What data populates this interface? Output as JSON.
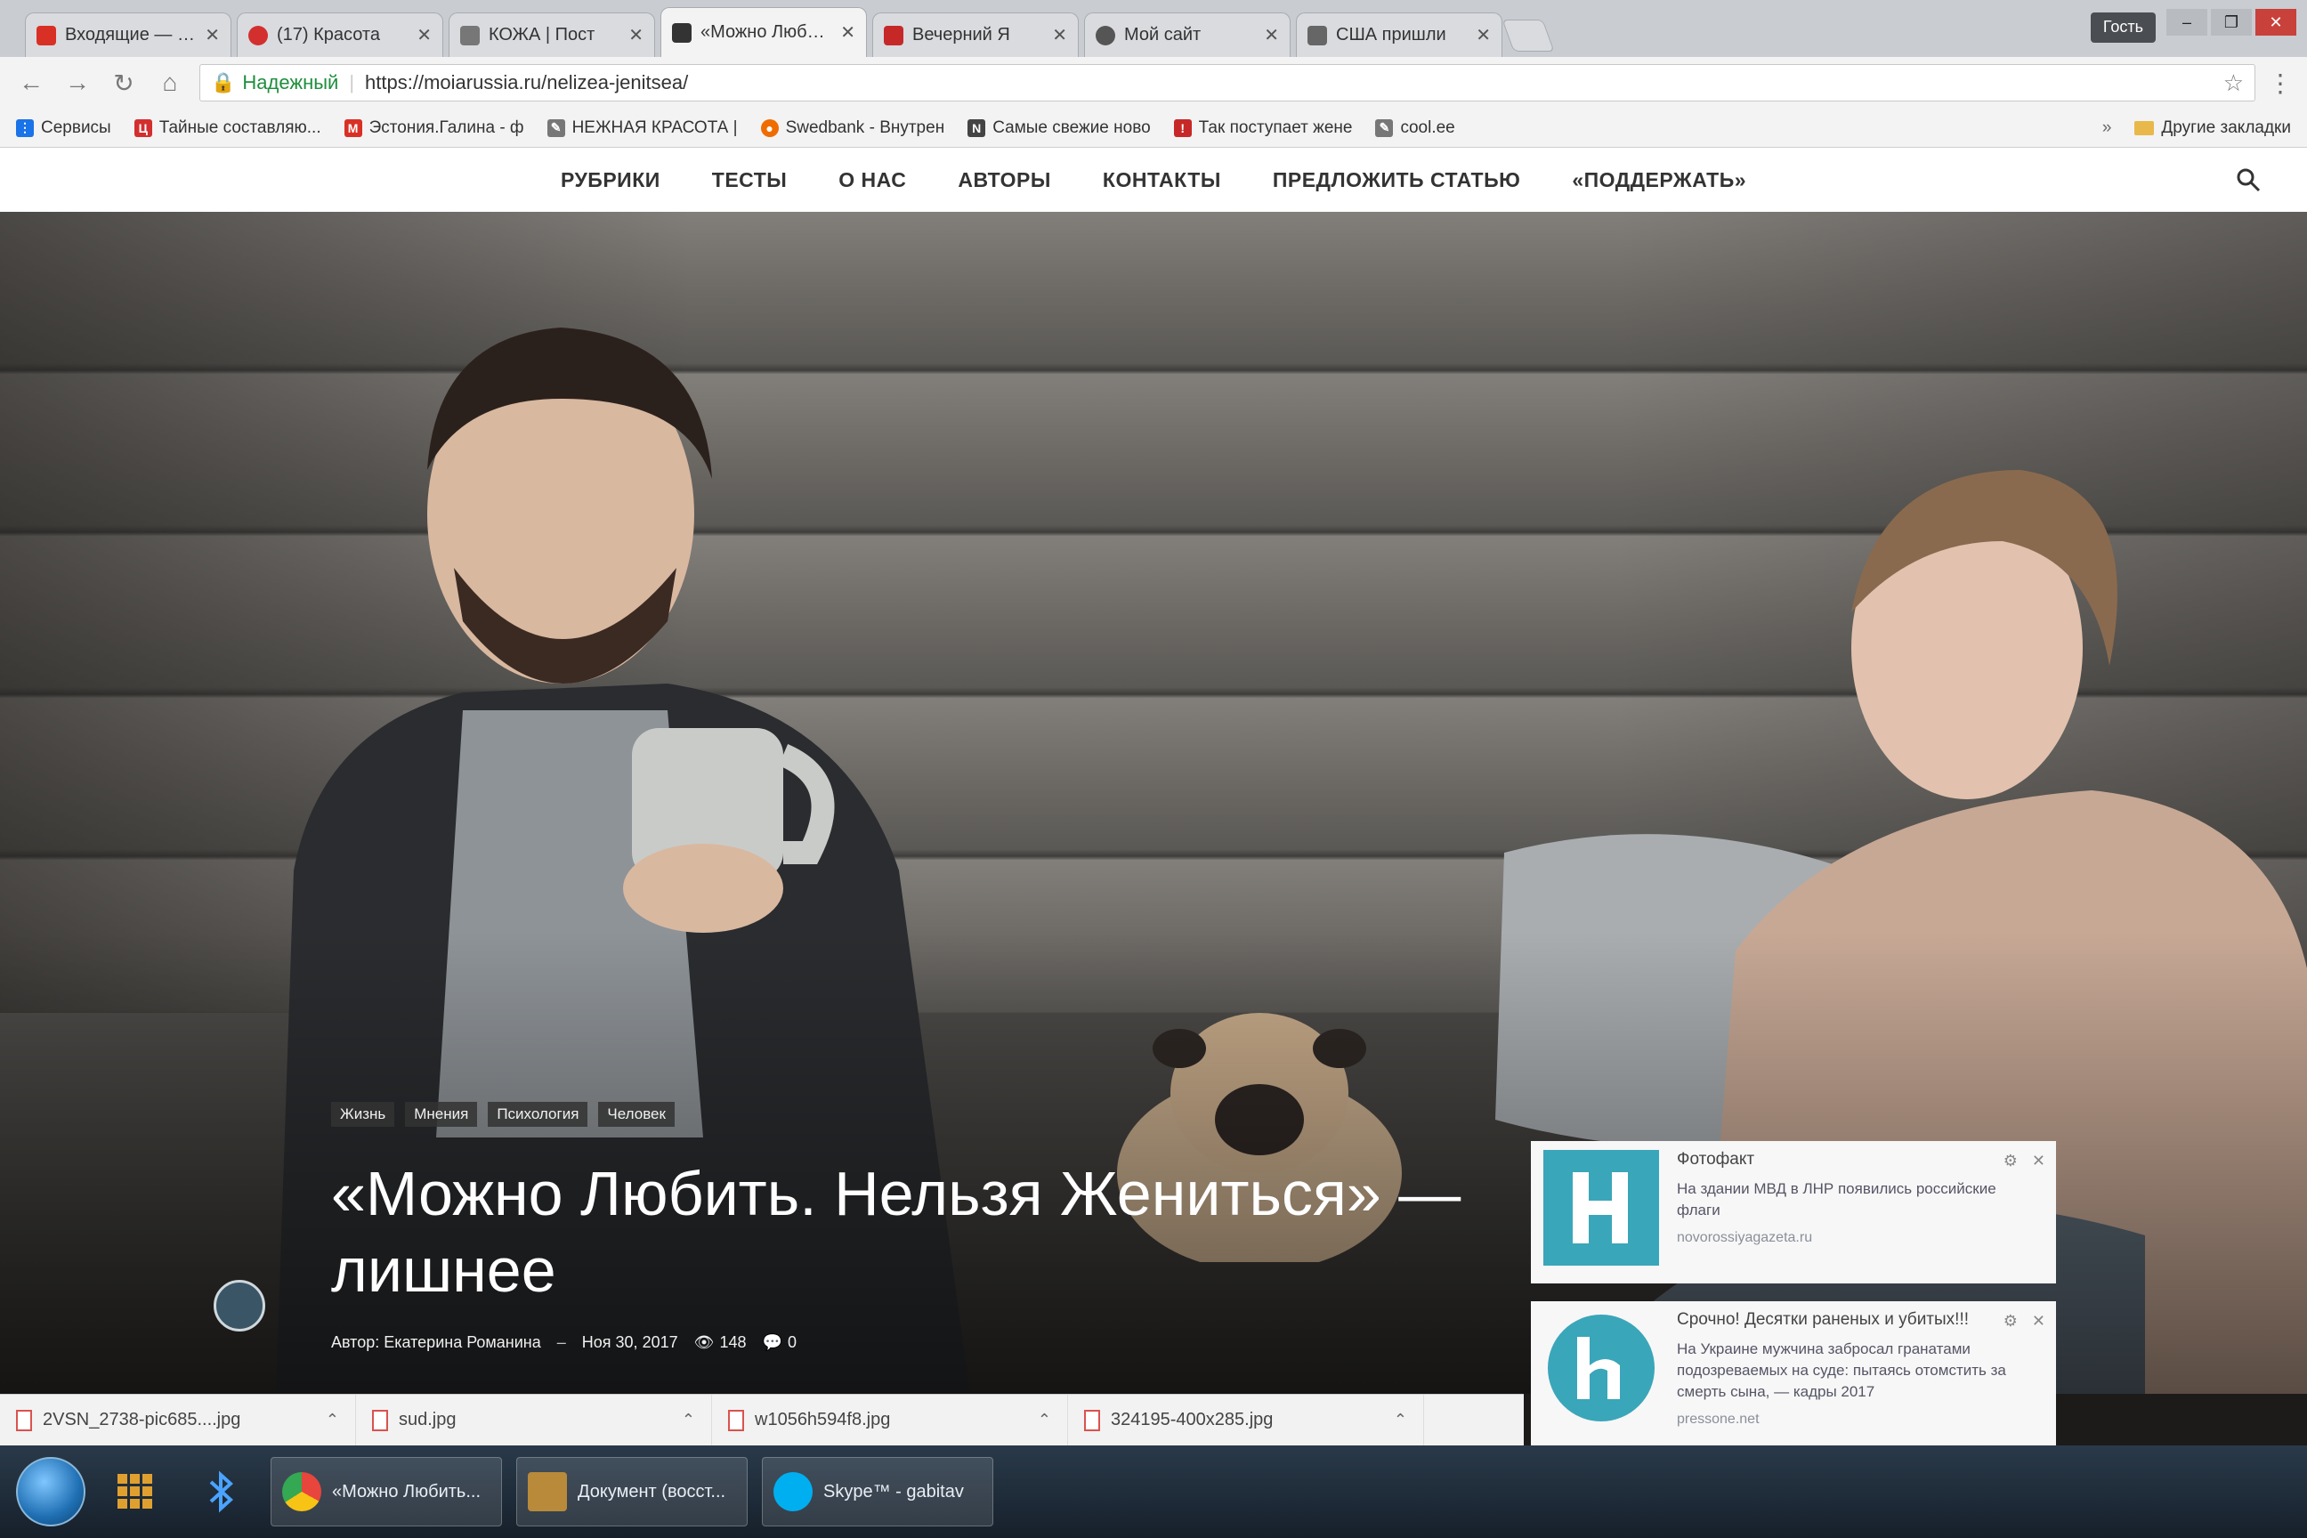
{
  "browser": {
    "tabs": [
      {
        "title": "Входящие — Gmail",
        "favicon_color": "#d93025",
        "active": false
      },
      {
        "title": "(17) Красота",
        "favicon_color": "#d32f2f",
        "active": false
      },
      {
        "title": "КОЖА | Пост",
        "favicon_color": "#777777",
        "active": false
      },
      {
        "title": "«Можно Любить",
        "favicon_color": "#333333",
        "active": true
      },
      {
        "title": "Вечерний Я",
        "favicon_color": "#c62828",
        "active": false
      },
      {
        "title": "Мой сайт",
        "favicon_color": "#555555",
        "active": false
      },
      {
        "title": "США пришли",
        "favicon_color": "#666666",
        "active": false
      }
    ],
    "user_chip": "Гость",
    "window_controls": [
      "–",
      "❐",
      "✕"
    ],
    "secure_label": "Надежный",
    "url": "https://moiarussia.ru/nelizea-jenitsea/",
    "bookmarks": [
      {
        "label": "Сервисы",
        "color": "#1a73e8",
        "glyph": "⋮"
      },
      {
        "label": "Тайные составляю...",
        "color": "#d32f2f",
        "glyph": "Ц"
      },
      {
        "label": "Эстония.Галина - ф",
        "color": "#d93025",
        "glyph": "M"
      },
      {
        "label": "НЕЖНАЯ КРАСОТА |",
        "color": "#777777",
        "glyph": "✎"
      },
      {
        "label": "Swedbank - Внутрен",
        "color": "#ef6c00",
        "glyph": "●"
      },
      {
        "label": "Самые свежие ново",
        "color": "#444444",
        "glyph": "N"
      },
      {
        "label": "Так поступает жене",
        "color": "#c62828",
        "glyph": "!"
      },
      {
        "label": "cool.ee",
        "color": "#777777",
        "glyph": "✎"
      }
    ],
    "bookmarks_more": "»",
    "other_bookmarks": "Другие закладки"
  },
  "site": {
    "nav": [
      "РУБРИКИ",
      "ТЕСТЫ",
      "О НАС",
      "АВТОРЫ",
      "КОНТАКТЫ",
      "ПРЕДЛОЖИТЬ СТАТЬЮ",
      "«ПОДДЕРЖАТЬ»"
    ]
  },
  "article": {
    "tags": [
      "Жизнь",
      "Мнения",
      "Психология",
      "Человек"
    ],
    "title": "«Можно Любить. Нельзя Жениться» — лишнее",
    "author": "Автор: Екатерина Романина",
    "date": "Ноя 30, 2017",
    "views": "148",
    "comments": "0"
  },
  "ads": [
    {
      "logo_bg": "#3aa6b9",
      "logo_letter": "H",
      "headline": "Фотофакт",
      "text": "На здании МВД в ЛНР появились российские флаги",
      "source": "novorossiyagazeta.ru"
    },
    {
      "logo_bg": "#ffffff",
      "logo_letter": "h",
      "headline": "Срочно! Десятки раненых и убитых!!!",
      "text": "На Украине мужчина забросал гранатами подозреваемых на суде: пытаясь отомстить за смерть сына, — кадры 2017",
      "source": "pressone.net"
    }
  ],
  "downloads": [
    "2VSN_2738-pic685....jpg",
    "sud.jpg",
    "w1056h594f8.jpg",
    "324195-400x285.jpg"
  ],
  "taskbar": {
    "tasks": [
      {
        "label": "«Можно Любить...",
        "color": "#e8453c"
      },
      {
        "label": "Документ (восст...",
        "color": "#b88a3a"
      },
      {
        "label": "Skype™ - gabitav",
        "color": "#00aff0"
      }
    ]
  },
  "colors": {
    "secure_green": "#1e8e3e",
    "nav_text": "#333333",
    "ad_teal": "#3aa6b9"
  }
}
